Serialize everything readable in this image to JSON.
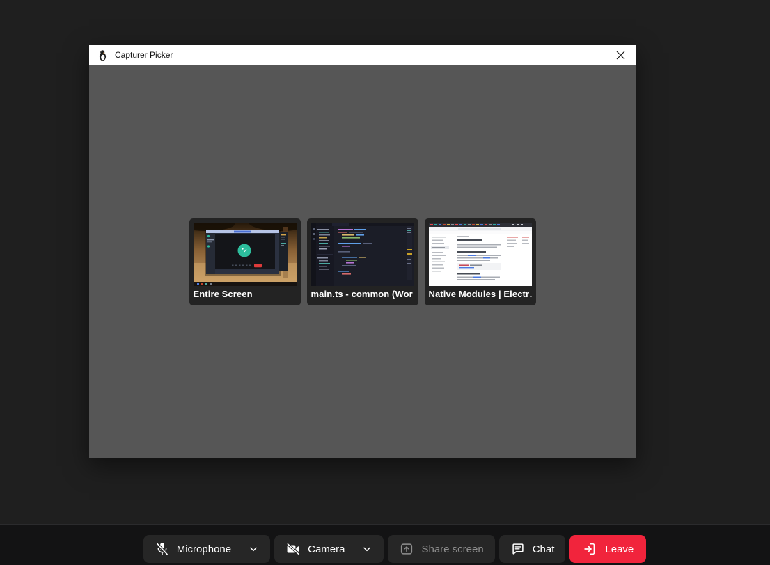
{
  "dialog": {
    "title": "Capturer Picker",
    "sources": [
      {
        "label": "Entire Screen"
      },
      {
        "label": "main.ts - common (Wor…"
      },
      {
        "label": "Native Modules | Electr…"
      }
    ]
  },
  "toolbar": {
    "microphone_label": "Microphone",
    "camera_label": "Camera",
    "share_screen_label": "Share screen",
    "chat_label": "Chat",
    "leave_label": "Leave"
  },
  "icons": {
    "app": "penguin-icon",
    "close": "close-icon",
    "microphone": "microphone-muted-icon",
    "camera": "camera-muted-icon",
    "share_screen": "screen-share-icon",
    "chat": "chat-bubble-icon",
    "leave": "leave-room-icon",
    "dropdown": "chevron-down-icon"
  },
  "colors": {
    "page_bg": "#1f1f1f",
    "titlebar_bg": "#ffffff",
    "dialog_body_bg": "#565656",
    "card_bg": "#232323",
    "control_button_bg": "#262626",
    "leave_red": "#f1243c",
    "disabled_text": "#8f8f8f",
    "avatar_teal": "#2dbd9c"
  }
}
